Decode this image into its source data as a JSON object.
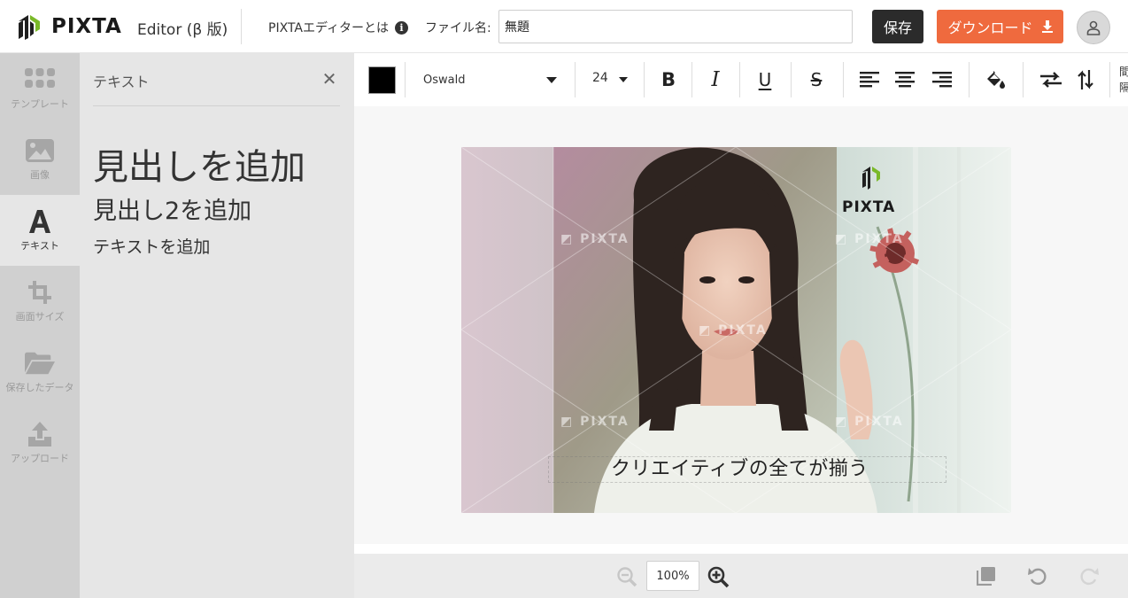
{
  "header": {
    "brand": "PIXTA",
    "editor_label": "Editor (β 版)",
    "about_link": "PIXTAエディターとは",
    "filename_label": "ファイル名:",
    "filename_value": "無題",
    "save_label": "保存",
    "download_label": "ダウンロード"
  },
  "sidebar": {
    "items": [
      {
        "label": "テンプレート",
        "icon": "template-grid-icon",
        "active": false
      },
      {
        "label": "画像",
        "icon": "image-icon",
        "active": false
      },
      {
        "label": "テキスト",
        "icon": "text-a-icon",
        "active": true
      },
      {
        "label": "画面サイズ",
        "icon": "crop-icon",
        "active": false
      },
      {
        "label": "保存したデータ",
        "icon": "folder-icon",
        "active": false
      },
      {
        "label": "アップロード",
        "icon": "upload-icon",
        "active": false
      }
    ]
  },
  "text_panel": {
    "title": "テキスト",
    "add_heading": "見出しを追加",
    "add_heading2": "見出し2を追加",
    "add_text": "テキストを追加"
  },
  "toolbar": {
    "text_color": "#000000",
    "font_family": "Oswald",
    "font_size": "24",
    "overflow_label": "間隔"
  },
  "canvas": {
    "caption": "クリエイティブの全てが揃う",
    "logo_text": "PIXTA",
    "watermark_text": "PIXTA"
  },
  "bottombar": {
    "zoom_value": "100%"
  },
  "colors": {
    "accent": "#ef6a3e",
    "save_button": "#2b2b2b",
    "sidebar_bg": "#d0d0d0",
    "panel_bg": "#e6e6e6"
  }
}
